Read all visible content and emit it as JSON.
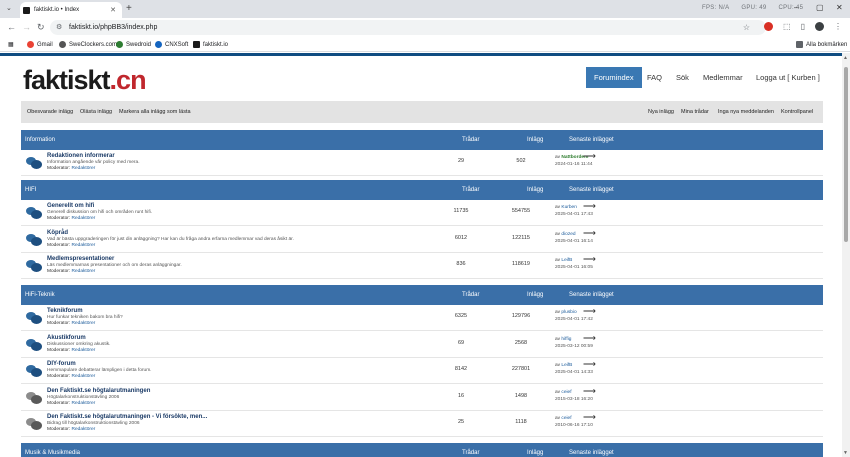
{
  "browser": {
    "tab_title": "faktiskt.io • Index",
    "url": "faktiskt.io/phpBB3/index.php",
    "hw_stats": [
      "FPS: N/A",
      "GPU: 49",
      "CPU: 45"
    ],
    "bookmarks": [
      {
        "label": "Gmail",
        "color": "#ea4335"
      },
      {
        "label": "SweClockers.com",
        "color": "#555555"
      },
      {
        "label": "Swedroid",
        "color": "#2e7d32"
      },
      {
        "label": "CNXSoft",
        "color": "#1565c0"
      },
      {
        "label": "faktiskt.io",
        "color": "#1a1a1a"
      }
    ],
    "all_bookmarks": "Alla bokmärken"
  },
  "header": {
    "logo_main": "faktiskt",
    "logo_tld": ".cn",
    "nav": [
      "Forumindex",
      "FAQ",
      "Sök",
      "Medlemmar",
      "Logga ut [ Kurben ]"
    ]
  },
  "subnav": {
    "left": [
      "Obesvarade inlägg",
      "Olästa inlägg",
      "Markera alla inlägg som lästa"
    ],
    "right": [
      "Nya inlägg",
      "Mina trådar",
      "Inga nya meddelanden",
      "Kontrollpanel"
    ]
  },
  "columns": {
    "topics": "Trådar",
    "posts": "Inlägg",
    "last": "Senaste inlägget"
  },
  "categories": [
    {
      "name": "Information",
      "forums": [
        {
          "title": "Redaktionen informerar",
          "desc": "Information angående vår policy med mera.",
          "mod_label": "Moderator:",
          "mod": "Redaktörer",
          "topics": "29",
          "posts": "502",
          "by": "av",
          "user": "Nattbordem",
          "user_green": true,
          "date": "2024-01-16 11:44",
          "grey": false
        }
      ]
    },
    {
      "name": "HIFI",
      "forums": [
        {
          "title": "Generellt om hifi",
          "desc": "Generell diskussion om hifi och områden runt hifi.",
          "mod_label": "Moderator:",
          "mod": "Redaktörer",
          "topics": "11735",
          "posts": "554755",
          "by": "av",
          "user": "Kurben",
          "user_green": false,
          "date": "2025-04-01 17:43",
          "grey": false
        },
        {
          "title": "Köpråd",
          "desc": "Vad är bästa uppgraderingen för just din anläggning? Har kan du fråga andra erfarna medlemmar vad deras åsikt är.",
          "mod_label": "Moderator:",
          "mod": "Redaktörer",
          "topics": "6012",
          "posts": "122115",
          "by": "av",
          "user": "diozed",
          "user_green": false,
          "date": "2025-04-01 16:14",
          "grey": false
        },
        {
          "title": "Medlemspresentationer",
          "desc": "Läs medlemmarnas presentationer och om deras anläggningar.",
          "mod_label": "Moderator:",
          "mod": "Redaktörer",
          "topics": "836",
          "posts": "118619",
          "by": "av",
          "user": "LeifB",
          "user_green": false,
          "date": "2025-04-01 16:05",
          "grey": false
        }
      ]
    },
    {
      "name": "HiFi-Teknik",
      "forums": [
        {
          "title": "Teknikforum",
          "desc": "Hur funkar tekniken bakom bra hifi?",
          "mod_label": "Moderator:",
          "mod": "Redaktörer",
          "topics": "6325",
          "posts": "129796",
          "by": "av",
          "user": "plusbio",
          "user_green": false,
          "date": "2025-04-01 17:42",
          "grey": false
        },
        {
          "title": "Akustikforum",
          "desc": "Diskussioner omkring akustik.",
          "mod_label": "Moderator:",
          "mod": "Redaktörer",
          "topics": "69",
          "posts": "2568",
          "by": "av",
          "user": "hiffig",
          "user_green": false,
          "date": "2025-03-12 00:59",
          "grey": false
        },
        {
          "title": "DIY-forum",
          "desc": "Hemmapulare debatterar lämpligen i detta forum.",
          "mod_label": "Moderator:",
          "mod": "Redaktörer",
          "topics": "8142",
          "posts": "227801",
          "by": "av",
          "user": "LeifB",
          "user_green": false,
          "date": "2025-04-01 14:33",
          "grey": false
        },
        {
          "title": "Den Faktiskt.se högtalarutmaningen",
          "desc": "Högtalarkonstruktionstävling 2006",
          "mod_label": "Moderator:",
          "mod": "Redaktörer",
          "topics": "16",
          "posts": "1498",
          "by": "av",
          "user": "ceief",
          "user_green": false,
          "date": "2015-03-18 16:20",
          "grey": true
        },
        {
          "title": "Den Faktiskt.se högtalarutmaningen - Vi försökte, men...",
          "desc": "Bidrag till högtalarkonstruktionstävling 2006",
          "mod_label": "Moderator:",
          "mod": "Redaktörer",
          "topics": "25",
          "posts": "1118",
          "by": "av",
          "user": "ceief",
          "user_green": false,
          "date": "2010-06-16 17:10",
          "grey": true
        }
      ]
    },
    {
      "name": "Musik & Musikmedia",
      "forums": []
    }
  ]
}
